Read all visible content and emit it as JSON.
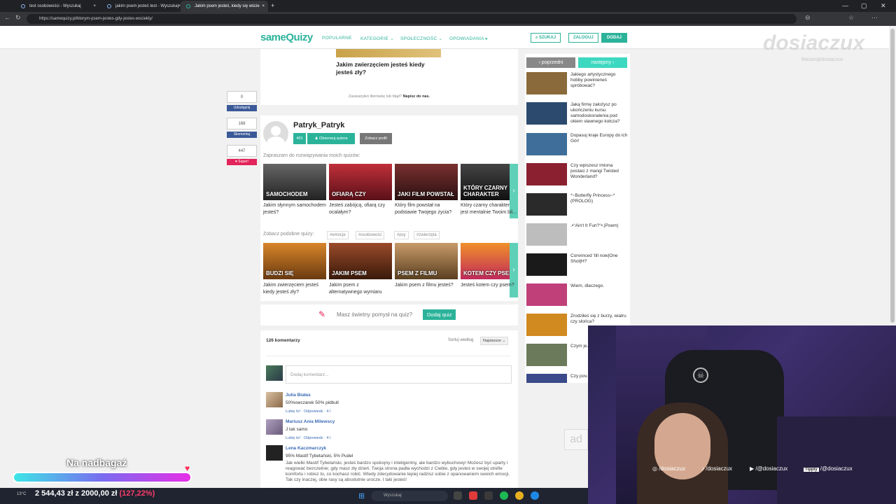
{
  "browser": {
    "tabs": [
      {
        "label": "test osobowości - Wyszukaj",
        "active": false
      },
      {
        "label": "jakim psem jesteś test - Wyszukaj",
        "active": false
      },
      {
        "label": "Jakim psem jesteś, kiedy się wście",
        "active": true
      }
    ],
    "url": "https://samequizy.pl/ktorym-psem-jestes-gdy-jestes-wsciekly/"
  },
  "site": {
    "logo": "sameQuizy",
    "menu": [
      "POPULARNE",
      "KATEGORIE ⌄",
      "SPOŁECZNOŚĆ ⌄",
      "OPOWIADANIA ▸"
    ],
    "search_label": "SZUKAJ",
    "login_label": "ZALOGUJ",
    "add_label": "DODAJ"
  },
  "main": {
    "top_caption": "Jakim zwierzęciem jesteś kiedy jesteś zły?",
    "typo_note": "Zauważyłeś literówkę lub błąd?",
    "typo_link": "Napisz do nas.",
    "votes": [
      {
        "count": "0",
        "label": "Udostępnij",
        "color": "#3b5998"
      },
      {
        "count": "168",
        "label": "Skomentuj",
        "color": "#3b5998"
      },
      {
        "count": "447",
        "label": "♥ Super!",
        "color": "#e2245a"
      }
    ],
    "author": {
      "name": "Patryk_Patryk",
      "count": "401",
      "follow_label": "Obserwuj autora",
      "profile_label": "Zobacz profil",
      "invite": "Zapraszam do rozwiązywania moich quizów:"
    },
    "author_quizzes": [
      {
        "title": "Jakim słynnym samochodem jesteś?",
        "thumb_text": "SAMOCHODEM",
        "color": "#3a3a3a"
      },
      {
        "title": "Jesteś zabójcą, ofiarą czy ocalałym?",
        "thumb_text": "OFIARĄ CZY",
        "color": "#8b1f2a"
      },
      {
        "title": "Który film powstał na podstawie Twojego życia?",
        "thumb_text": "JAKI FILM POWSTAŁ",
        "color": "#5a2020"
      },
      {
        "title": "Który czarny charakter jest mentalnie Twoim bli...",
        "thumb_text": "KTÓRY CZARNY CHARAKTER",
        "color": "#1e1e1e"
      }
    ],
    "similar_label": "Zobacz podobne quizy:",
    "tags": [
      "#emocje",
      "#osobowość",
      "#psy",
      "#zwierzęta"
    ],
    "similar_quizzes": [
      {
        "title": "Jakim zwierzęciem jesteś kiedy jesteś zły?",
        "thumb_text": "BUDZI SIĘ",
        "color": "#b5651d"
      },
      {
        "title": "Jakim psem z alternatywnego wymiaru",
        "thumb_text": "JAKIM PSEM",
        "color": "#7a3f1f"
      },
      {
        "title": "Jakim psem z filmu jesteś?",
        "thumb_text": "PSEM Z FILMU",
        "color": "#a97c4a"
      },
      {
        "title": "Jesteś kotem czy psem?",
        "thumb_text": "KOTEM CZY PSEM",
        "color": "#e36a2c"
      }
    ],
    "idea_text": "Masz świetny pomysł na quiz?",
    "idea_button": "Dodaj quiz"
  },
  "comments": {
    "count_label": "126 komentarzy",
    "sort_label": "Sortuj według",
    "sort_value": "Najstarsze ⌄",
    "input_placeholder": "Dodaj komentarz...",
    "items": [
      {
        "author": "Julia Białas",
        "text": "50%owczarek 50% pidbull",
        "meta": "Lubię to! · Odpowiedz · 4 l"
      },
      {
        "author": "Mariusz Ania Milewscy",
        "text": "J tak samo",
        "meta": "Lubię to! · Odpowiedz · 4 l"
      },
      {
        "author": "Lena Kaczmarczyk",
        "text": "95% Mastif Tybetański, 5% Pudel",
        "long": "Jak wielki Mastif Tybetański, jesteś bardzo spokojny i inteligentny, ale bardzo wybuchowy! Możesz być uparty i reagować bezczelnie; gdy masz zły dzień. Twoja strona padła wychodzi z Ciebie, gdy jesteś w swojej strefie komfortu i robisz to, co kochasz robić. Wtedy zdecydowanie lepiej radzisz sobie z opanowaniem swoich emocji. Tak czy inaczej, obie rasy są absolutnie urocze. I taki jesteś!"
      }
    ]
  },
  "sidebar": {
    "prev_label": "‹ poprzedni",
    "next_label": "następny ›",
    "items": [
      {
        "title": "Jakiego artystycznego hobby powinieneś spróbować?",
        "color": "#8a6a3a"
      },
      {
        "title": "Jaką firmę założysz po ukończeniu kursu samodoskonalenia pod okiem sławnego kołcza?",
        "color": "#2c4a6e"
      },
      {
        "title": "Dopasuj kraje Europy do ich Gór!",
        "color": "#3f6e9a"
      },
      {
        "title": "Czy wpiszesz imiona postaci z mangi Twisted Wonderland?",
        "color": "#8a2030"
      },
      {
        "title": "*~Butterfly Princess~* (PROLOG)",
        "color": "#2a2a2a"
      },
      {
        "title": ".•°Ain't It Fun?°•.|Poem|",
        "color": "#bdbdbd"
      },
      {
        "title": "Convinced 'till now|One Shot|H?",
        "color": "#1a1a1a"
      },
      {
        "title": "Wiem, dlaczego.",
        "color": "#c0407a"
      },
      {
        "title": "Zrodziłeś się z burzy, wiatru czy słońca?",
        "color": "#d08a20"
      },
      {
        "title": "Czym je... twój sm...",
        "color": "#6a7a5a"
      },
      {
        "title": "Czy pov... książk...",
        "color": "#3a4a8a"
      }
    ]
  },
  "watermark": {
    "text": "dosiaczux",
    "sub": "Bitcoin@dosiaczux"
  },
  "stream": {
    "goal_title": "Na nadbagaż",
    "goal_amount": "2 544,43 zł z 2000,00 zł",
    "goal_percent": "(127,22%)",
    "socials": [
      "/dosiaczux",
      "/dosiaczux",
      "/@dosiaczux",
      "/@dosiaczux"
    ],
    "tippy_label": "Tipply"
  },
  "taskbar": {
    "search": "Wyszukaj",
    "weather": "13°C"
  }
}
